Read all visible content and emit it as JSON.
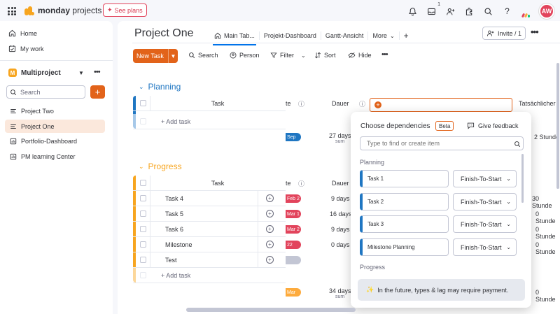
{
  "app": {
    "brand": "monday",
    "brand_suffix": " projects",
    "see_plans": "See plans",
    "notification_count": "1",
    "avatar_initials": "AW",
    "accent_color": "#e2631a"
  },
  "sidebar": {
    "home": "Home",
    "my_work": "My work",
    "workspace_initial": "M",
    "workspace_name": "Multiproject",
    "search_placeholder": "Search",
    "boards": [
      {
        "label": "Project Two",
        "icon": "board-icon"
      },
      {
        "label": "Project One",
        "icon": "board-icon",
        "active": true
      },
      {
        "label": "Portfolio-Dashboard",
        "icon": "dashboard-icon"
      },
      {
        "label": "PM learning Center",
        "icon": "dashboard-icon"
      }
    ]
  },
  "board": {
    "title": "Project One",
    "tabs": [
      "Main Tab...",
      "Projekt-Dashboard",
      "Gantt-Ansicht",
      "More"
    ],
    "invite": "Invite / 1"
  },
  "toolbar": {
    "new_task": "New Task",
    "search": "Search",
    "person": "Person",
    "filter": "Filter",
    "sort": "Sort",
    "hide": "Hide"
  },
  "columns": {
    "task": "Task",
    "timeline_partial": "te",
    "duration": "Dauer",
    "actual_partial": "Tatsächlicher"
  },
  "groups": [
    {
      "name": "Planning",
      "color": "#1f76c2",
      "add_task": "+ Add task",
      "summary_timeline": "Sep",
      "summary_duration": "27 days",
      "summary_label": "sum",
      "summary_actual": "2 Stunde"
    },
    {
      "name": "Progress",
      "color": "#f7a51f",
      "add_task": "+ Add task",
      "rows": [
        {
          "task": "Task 4",
          "timeline": "Feb 2",
          "timeline_color": "#e2445c",
          "duration": "9 days",
          "actual": "30 Stunde"
        },
        {
          "task": "Task 5",
          "timeline": "Mar 1",
          "timeline_color": "#e2445c",
          "duration": "16 days",
          "actual": "0 Stunde"
        },
        {
          "task": "Task 6",
          "timeline": "Mar 2",
          "timeline_color": "#e2445c",
          "duration": "9 days",
          "actual": "0 Stunde"
        },
        {
          "task": "Milestone",
          "timeline": "22",
          "timeline_color": "#e2445c",
          "duration": "0 days",
          "actual": "0 Stunde"
        },
        {
          "task": "Test",
          "timeline": "",
          "timeline_color": "#c3c6d4",
          "duration": "",
          "actual": ""
        }
      ],
      "summary_timeline": "Mar",
      "summary_duration": "34 days",
      "summary_label": "sum",
      "summary_actual": "0 Stunde"
    }
  ],
  "dependencies": {
    "title": "Choose dependencies",
    "beta": "Beta",
    "feedback": "Give feedback",
    "input_placeholder": "Type to find or create item",
    "section_planning": "Planning",
    "section_progress": "Progress",
    "items": [
      {
        "task": "Task 1",
        "type": "Finish-To-Start"
      },
      {
        "task": "Task 2",
        "type": "Finish-To-Start"
      },
      {
        "task": "Task 3",
        "type": "Finish-To-Start"
      },
      {
        "task": "Milestone Planning",
        "type": "Finish-To-Start"
      }
    ],
    "note": "In the future, types & lag may require payment."
  }
}
